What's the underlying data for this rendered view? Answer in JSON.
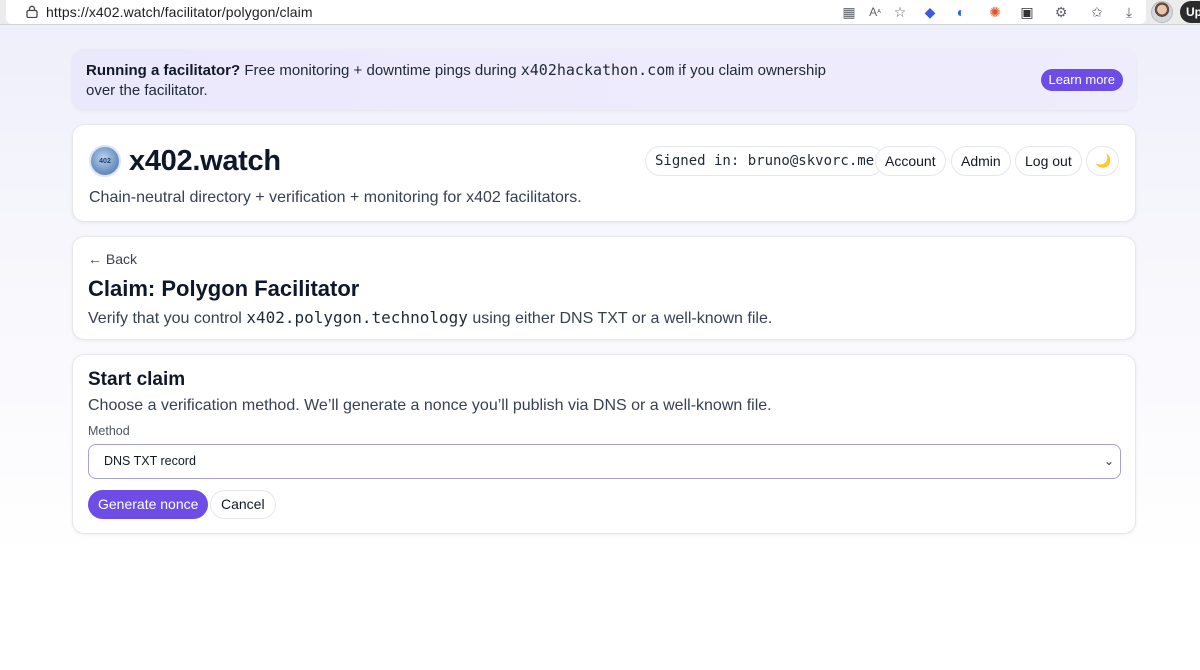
{
  "browser": {
    "url": "https://x402.watch/facilitator/polygon/claim",
    "profile_button_label": "Up",
    "toolbar_icons": [
      "reader-view-icon",
      "read-aloud-icon",
      "favorite-star-icon",
      "extension-icon",
      "extension-icon",
      "extension-icon",
      "extension-icon",
      "extensions-puzzle-icon",
      "favorites-icon",
      "downloads-icon",
      "profile-avatar-icon"
    ]
  },
  "banner": {
    "bold_text": "Running a facilitator?",
    "text_before": " Free monitoring + downtime pings during ",
    "code": "x402hackathon.com",
    "text_after": " if you claim ownership over the facilitator.",
    "button_label": "Learn more"
  },
  "header": {
    "logo_text": "402",
    "title": "x402.watch",
    "tagline": "Chain-neutral directory + verification + monitoring for x402 facilitators.",
    "signed_in": "Signed in: bruno@skvorc.me",
    "nav": {
      "account": "Account",
      "admin": "Admin",
      "logout": "Log out",
      "theme_icon": "🌙"
    }
  },
  "claim": {
    "back_label": "← Back",
    "title": "Claim: Polygon Facilitator",
    "sub_before": "Verify that you control ",
    "domain": "x402.polygon.technology",
    "sub_after": " using either DNS TXT or a well-known file."
  },
  "start": {
    "title": "Start claim",
    "description": "Choose a verification method. We’ll generate a nonce you’ll publish via DNS or a well-known file.",
    "method_label": "Method",
    "method_value": "DNS TXT record",
    "generate_label": "Generate nonce",
    "cancel_label": "Cancel"
  },
  "colors": {
    "accent": "#6d4de6",
    "banner_bg": "#eae8fb",
    "border": "#e5e7eb"
  }
}
